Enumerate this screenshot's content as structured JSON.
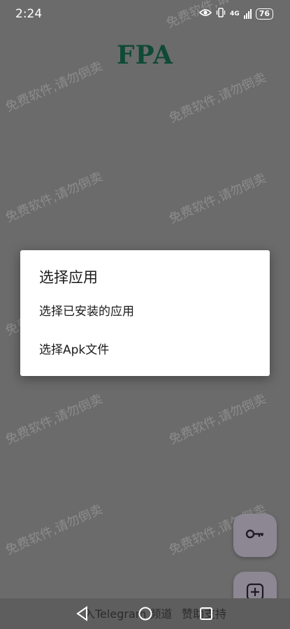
{
  "status_bar": {
    "time": "2:24",
    "network": "4G",
    "battery": "76"
  },
  "app": {
    "title": "FPA",
    "title_color": "#0f4a36"
  },
  "watermark": {
    "text": "免费软件,请勿倒卖"
  },
  "dialog": {
    "title": "选择应用",
    "options": [
      "选择已安装的应用",
      "选择Apk文件"
    ]
  },
  "fabs": {
    "key_icon": "key-icon",
    "add_icon": "plus-square-icon"
  },
  "bottom_bar": {
    "telegram_link": "入Telegram 频道",
    "support_link": "赞助支持"
  },
  "nav": {
    "back_icon": "back-triangle-icon",
    "home_icon": "home-circle-icon",
    "recent_icon": "recent-square-icon"
  }
}
